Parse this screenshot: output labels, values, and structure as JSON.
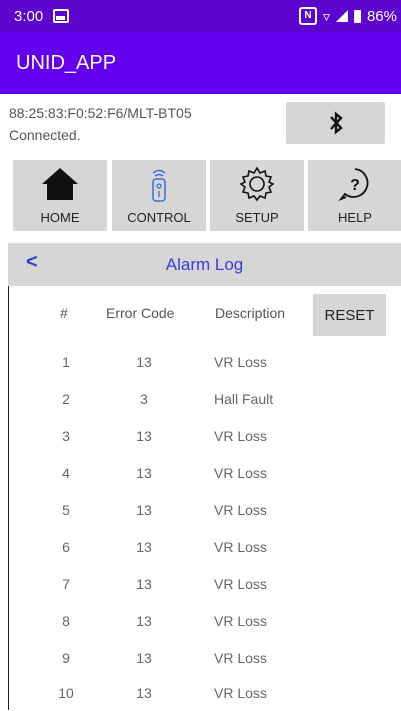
{
  "status_bar": {
    "time": "3:00",
    "battery_text": "86%"
  },
  "app_bar": {
    "title": "UNID_APP"
  },
  "connection": {
    "device": "88:25:83:F0:52:F6/MLT-BT05",
    "status": "Connected."
  },
  "nav": [
    {
      "label": "HOME",
      "icon": "home-icon"
    },
    {
      "label": "CONTROL",
      "icon": "remote-icon"
    },
    {
      "label": "SETUP",
      "icon": "gear-icon"
    },
    {
      "label": "HELP",
      "icon": "help-icon"
    }
  ],
  "page": {
    "back": "<",
    "title": "Alarm Log"
  },
  "table": {
    "headers": [
      "#",
      "Error Code",
      "Description"
    ],
    "reset_label": "RESET",
    "rows": [
      {
        "num": "1",
        "code": "13",
        "desc": "VR Loss"
      },
      {
        "num": "2",
        "code": "3",
        "desc": "Hall Fault"
      },
      {
        "num": "3",
        "code": "13",
        "desc": "VR Loss"
      },
      {
        "num": "4",
        "code": "13",
        "desc": "VR Loss"
      },
      {
        "num": "5",
        "code": "13",
        "desc": "VR Loss"
      },
      {
        "num": "6",
        "code": "13",
        "desc": "VR Loss"
      },
      {
        "num": "7",
        "code": "13",
        "desc": "VR Loss"
      },
      {
        "num": "8",
        "code": "13",
        "desc": "VR Loss"
      },
      {
        "num": "9",
        "code": "13",
        "desc": "VR Loss"
      },
      {
        "num": "10",
        "code": "13",
        "desc": "VR Loss"
      }
    ]
  },
  "colors": {
    "status_bar": "#5b05cf",
    "app_bar": "#6200ee",
    "button_gray": "#d6d6d6",
    "accent_blue": "#3a3adf"
  }
}
